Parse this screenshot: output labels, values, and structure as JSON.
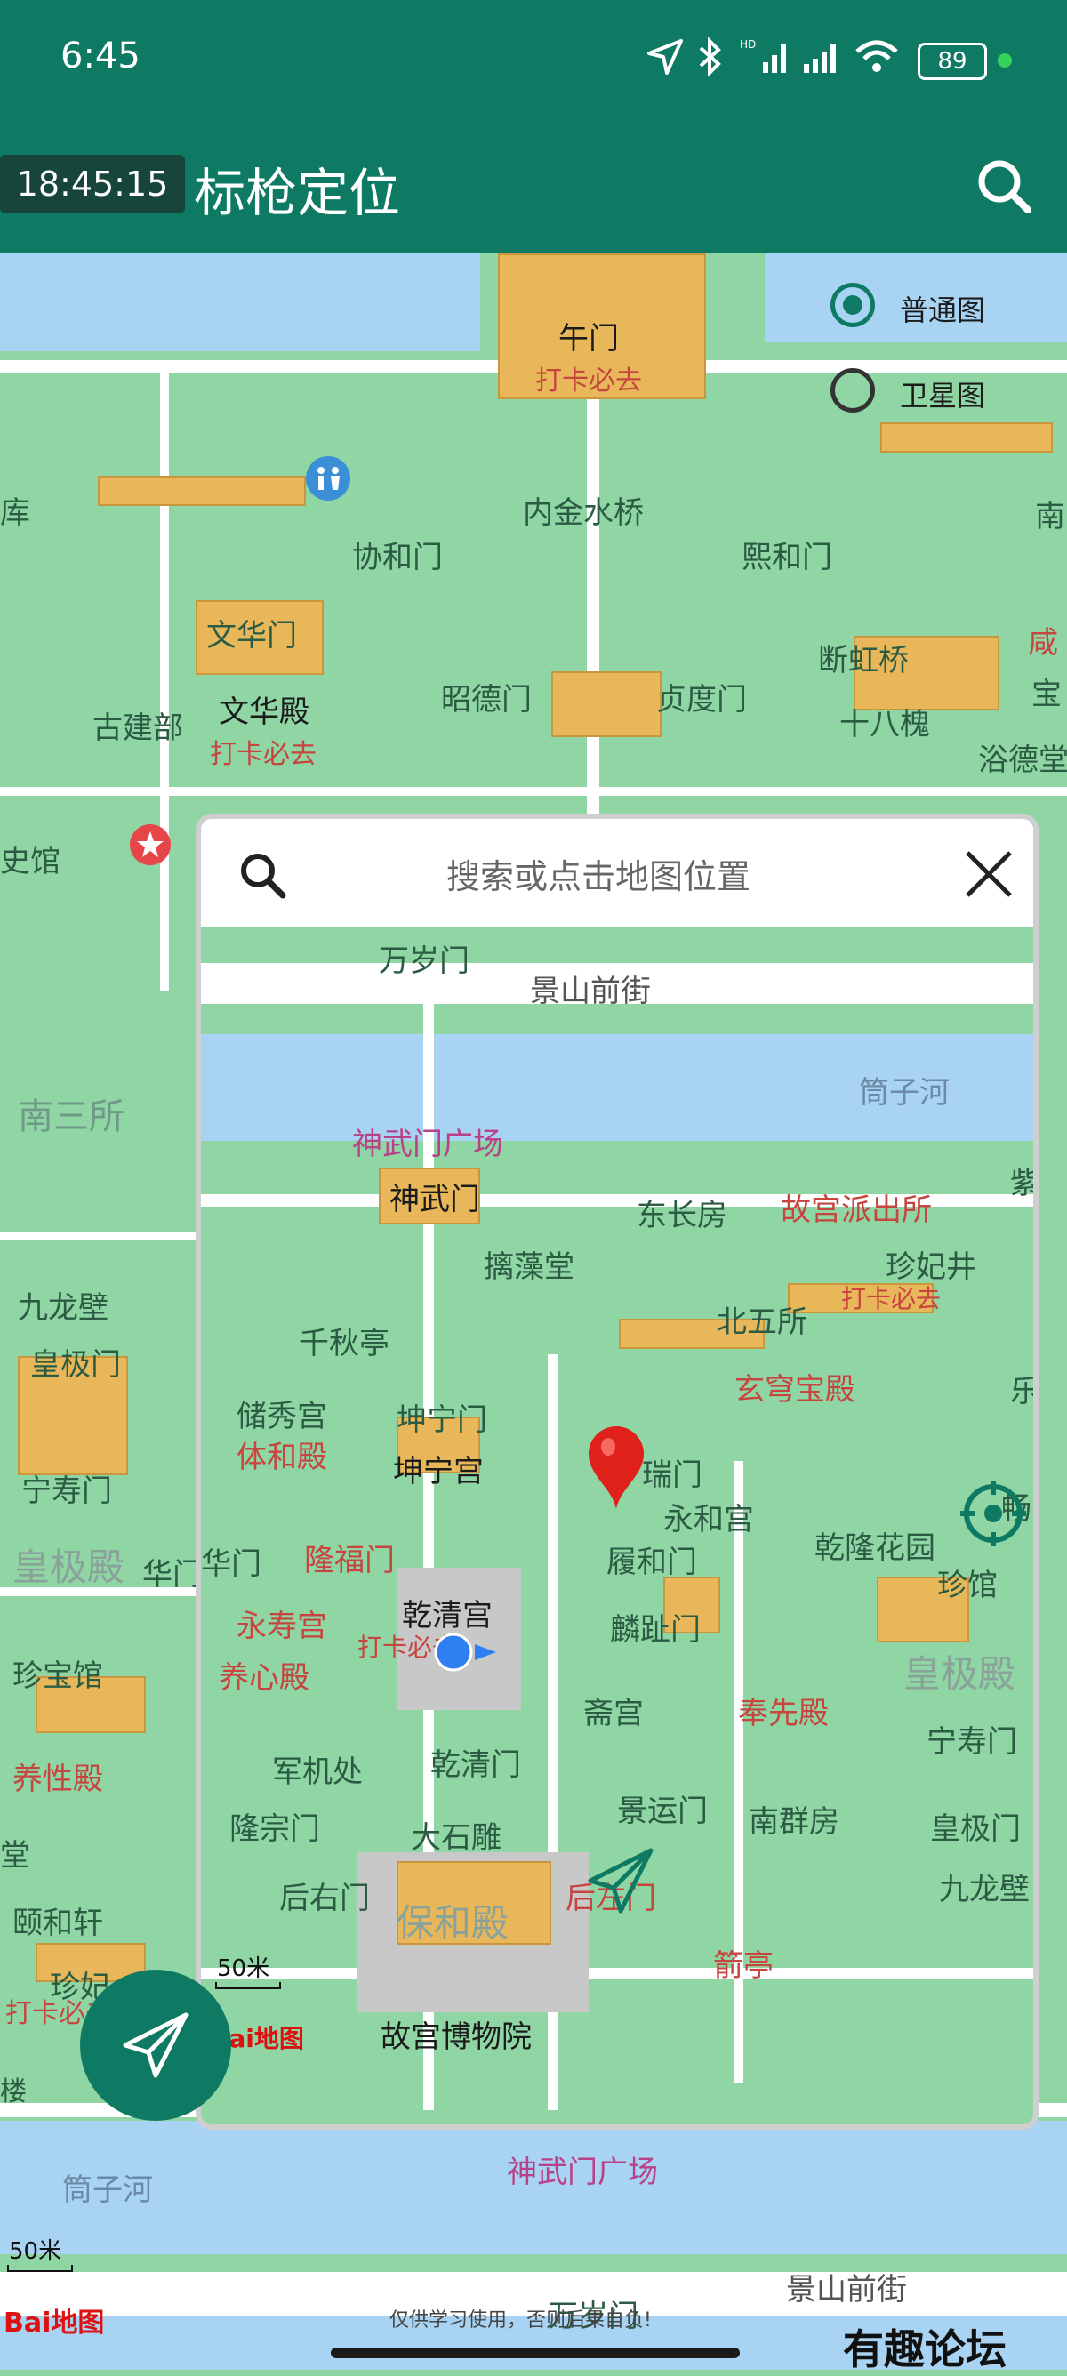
{
  "status_bar": {
    "time": "6:45",
    "battery": "89"
  },
  "app_bar": {
    "overlay_time": "18:45:15",
    "title": "标枪定位"
  },
  "layers": {
    "normal": "普通图",
    "satellite": "卫星图",
    "selected": "普通图"
  },
  "search": {
    "placeholder": "搜索或点击地图位置"
  },
  "main_map": {
    "labels": {
      "wumen": "午门",
      "daka1": "打卡必去",
      "neijinshuiqiao": "内金水桥",
      "xiehemen": "协和门",
      "xihemen": "熙和门",
      "wenhuamen": "文华门",
      "wenhuadian": "文华殿",
      "daka2": "打卡必去",
      "gujianbu": "古建部",
      "zhaodemen": "昭德门",
      "zhendumen": "贞度门",
      "duanhongqiao": "断虹桥",
      "shibahuai": "十八槐",
      "yudefang": "浴德堂",
      "ku": "库",
      "nan": "南",
      "xian": "咸",
      "bao": "宝",
      "shiguan": "史馆",
      "nansansuo": "南三所",
      "jiulongbi": "九龙壁",
      "huangjimen": "皇极门",
      "ningshoumen": "宁寿门",
      "huangjidian": "皇极殿",
      "huamen": "华门",
      "zhenbaoguan": "珍宝馆",
      "yangxingdian": "养性殿",
      "tang": "堂",
      "yihexuan": "颐和轩",
      "zhenfei": "珍妃",
      "daka3": "打卡必去",
      "lou": "楼",
      "tongzihe": "筒子河",
      "shenwumen_plaza": "神武门广场",
      "jingshanqianjie": "景山前街",
      "wansuimen": "万岁门",
      "disclaimer": "仅供学习使用，否则后果自负!"
    },
    "scale": "50米"
  },
  "mini_map": {
    "labels": {
      "wansuimen": "万岁门",
      "jingshanqianjie": "景山前街",
      "tongzihe": "筒子河",
      "shenwumen_plaza": "神武门广场",
      "zi": "紫",
      "shenwumen": "神武门",
      "dongchangfang": "东长房",
      "paichusuo": "故宫派出所",
      "gong": "宫",
      "shizaotang": "摛藻堂",
      "zhenfeijing": "珍妃井",
      "daka1": "打卡必去",
      "beiwusuo": "北五所",
      "qianqiuting": "千秋亭",
      "xuanqiongbaodian": "玄穹宝殿",
      "le": "乐",
      "chuxiugong": "储秀宫",
      "kunningmen": "坤宁门",
      "tihedian": "体和殿",
      "ruimen": "瑞门",
      "kunninggong": "坤宁宫",
      "yonghegong": "永和宫",
      "qianlonghuayuan": "乾隆花园",
      "chang": "畅",
      "huamen": "华门",
      "longfumen": "隆福门",
      "lvhemen": "履和门",
      "zhenguan": "珍馆",
      "yongshougong": "永寿宫",
      "qianqinggong": "乾清宫",
      "daka2": "打卡必去",
      "linzhimen": "麟趾门",
      "huangjidian": "皇极殿",
      "yangxindian": "养心殿",
      "zhaigong": "斋宫",
      "fengxiandian": "奉先殿",
      "ningshoumen": "宁寿门",
      "junjichu": "军机处",
      "qianqingmen": "乾清门",
      "jingyunmen": "景运门",
      "nanqunfang": "南群房",
      "huangjimen": "皇极门",
      "longzongmen": "隆宗门",
      "dashidiao": "大石雕",
      "jiulongbi": "九龙壁",
      "houyoumen": "后右门",
      "baohedian": "保和殿",
      "houzuomen": "后左门",
      "jianting": "箭亭",
      "gugongbowuyuan": "故宫博物院"
    },
    "scale": "50米"
  },
  "watermark": "有趣论坛",
  "logo": "Bai地图",
  "colors": {
    "primary": "#0f7a63",
    "map_green": "#8fd6a4",
    "road": "#ffffff",
    "water": "#a9d3f2",
    "building": "#e8b75a",
    "marker": "#e0201b",
    "location_dot": "#2f7ff0"
  },
  "icons": [
    "menu-icon",
    "search-icon",
    "location-arrow-icon",
    "bluetooth-icon",
    "signal-icon",
    "wifi-icon",
    "battery-icon",
    "close-icon",
    "send-icon",
    "locate-target-icon",
    "map-marker-icon",
    "restroom-icon",
    "attraction-star-icon"
  ]
}
